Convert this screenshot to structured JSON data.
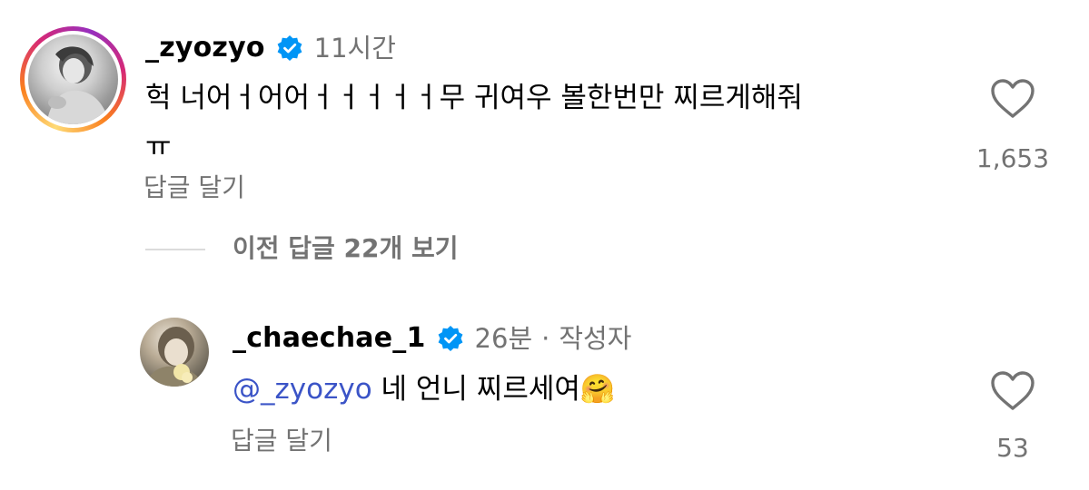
{
  "comment": {
    "username": "_zyozyo",
    "time": "11시간",
    "text_line1": "헉 너어ㅓ어어ㅓㅓㅓㅓㅓ무 귀여우 볼한번만 찌르게해줘",
    "text_line2": "ㅠ",
    "reply_label": "답글 달기",
    "likes": "1,653",
    "icons": {
      "verified": "verified-badge-icon",
      "like": "heart-outline-icon"
    }
  },
  "view_replies": {
    "label": "이전 답글 22개 보기"
  },
  "reply": {
    "username": "_chaechae_1",
    "time": "26분",
    "separator": "·",
    "author_tag": "작성자",
    "mention": "@_zyozyo",
    "text": "네 언니 찌르세여",
    "emoji": "🤗",
    "reply_label": "답글 달기",
    "likes": "53"
  },
  "colors": {
    "verified_blue": "#0095f6",
    "mention_blue": "#3b54c7",
    "secondary_text": "#737373",
    "ring_gradient": [
      "#feda75",
      "#fa7e1e",
      "#d62976",
      "#962fbf"
    ]
  }
}
